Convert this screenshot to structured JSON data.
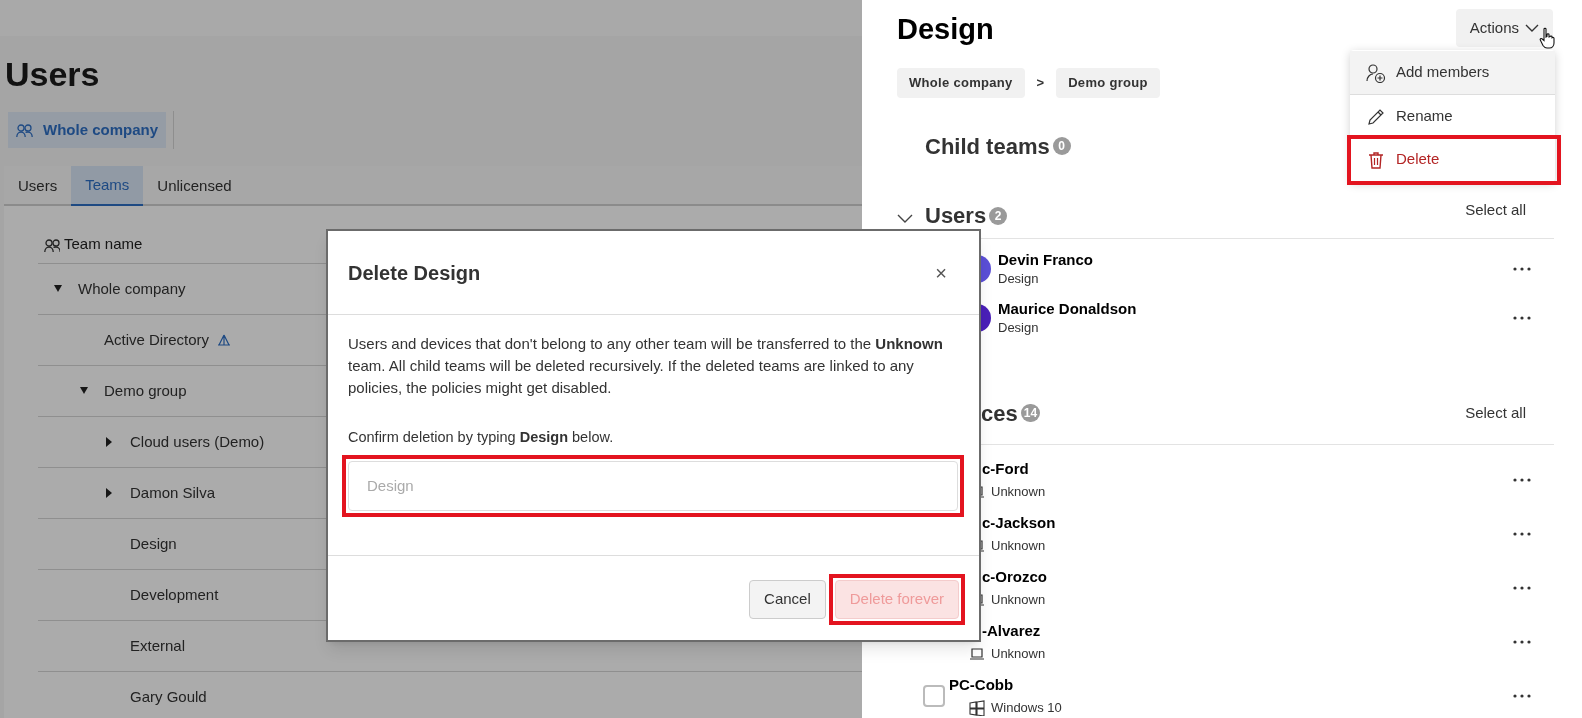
{
  "page": {
    "title": "Users",
    "scope_chip": "Whole company",
    "tabs": [
      {
        "label": "Users",
        "selected": false
      },
      {
        "label": "Teams",
        "selected": true
      },
      {
        "label": "Unlicensed",
        "selected": false
      }
    ],
    "tree": {
      "header": "Team name",
      "items": [
        {
          "label": "Whole company",
          "expanded": true,
          "children": [
            {
              "label": "Active Directory",
              "kind": "directory"
            },
            {
              "label": "Demo group",
              "expanded": true,
              "children": [
                {
                  "label": "Cloud users (Demo)",
                  "expanded": false
                },
                {
                  "label": "Damon Silva",
                  "expanded": false
                },
                {
                  "label": "Design"
                },
                {
                  "label": "Development"
                },
                {
                  "label": "External"
                },
                {
                  "label": "Gary Gould"
                }
              ]
            }
          ]
        }
      ]
    }
  },
  "drawer": {
    "title": "Design",
    "actions_button": "Actions",
    "actions_menu": [
      {
        "label": "Add members",
        "kind": "add",
        "hovered": true
      },
      {
        "label": "Rename",
        "kind": "rename",
        "hovered": false
      },
      {
        "label": "Delete",
        "kind": "delete",
        "hovered": false,
        "highlighted": true
      }
    ],
    "breadcrumbs": [
      "Whole company",
      "Demo group"
    ],
    "breadcrumb_separator": ">",
    "sections": [
      {
        "title": "Child teams",
        "count": "0"
      },
      {
        "title": "Users",
        "count": "2",
        "expanded": true,
        "select_all": "Select all",
        "kind": "users",
        "rows": [
          {
            "name": "Devin Franco",
            "team": "Design",
            "color": "#5b4fd6"
          },
          {
            "name": "Maurice Donaldson",
            "team": "Design",
            "color": "#4a1fb8"
          }
        ]
      },
      {
        "title": "ces",
        "count": "14",
        "select_all": "Select all",
        "kind": "devices",
        "rows": [
          {
            "name": "c-Ford",
            "os": "Unknown",
            "kind": "unknown"
          },
          {
            "name": "c-Jackson",
            "os": "Unknown",
            "kind": "unknown"
          },
          {
            "name": "c-Orozco",
            "os": "Unknown",
            "kind": "unknown"
          },
          {
            "name": "-Alvarez",
            "os": "Unknown",
            "kind": "unknown"
          },
          {
            "name": "PC-Cobb",
            "os": "Windows 10",
            "kind": "windows",
            "checked": false
          }
        ]
      }
    ]
  },
  "dialog": {
    "title": "Delete Design",
    "close": "×",
    "message": "Users and devices that don't belong to any other team will be transferred to the **Unknown** team. All child teams will be deleted recursively. If the deleted teams are linked to any policies, the policies might get disabled.",
    "confirm_label": "Confirm deletion by typing **Design** below.",
    "confirm_field": {
      "placeholder": "Design",
      "highlighted": true
    },
    "buttons": [
      {
        "label": "Cancel",
        "kind": "secondary"
      },
      {
        "label": "Delete forever",
        "kind": "danger",
        "disabled": true,
        "highlighted": true
      }
    ]
  }
}
